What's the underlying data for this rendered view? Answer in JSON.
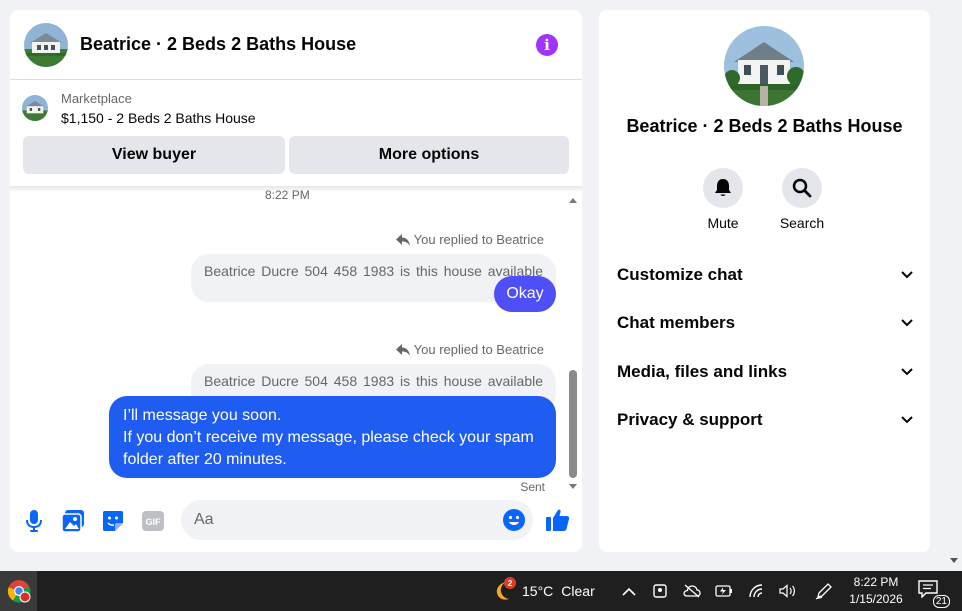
{
  "chat": {
    "title": "Beatrice · 2 Beds 2 Baths House",
    "info_glyph": "i",
    "marketplace_label": "Marketplace",
    "listing": "$1,150 - 2 Beds 2 Baths House",
    "view_buyer": "View buyer",
    "more_options": "More options",
    "timestamp": "8:22 PM",
    "messages": [
      {
        "reply_note": "You replied to Beatrice",
        "quote": "Beatrice  Ducre  504 458 1983 is this house available",
        "text": "Okay"
      },
      {
        "reply_note": "You replied to Beatrice",
        "quote": "Beatrice  Ducre  504 458 1983 is this house available",
        "lines": [
          "I’ll message you soon.",
          "If you don’t receive my message, please check your spam",
          "folder after 20 minutes."
        ]
      }
    ],
    "status": "Sent",
    "composer_placeholder": "Aa",
    "accent": "#0866ff",
    "bubble_colors": [
      "#4e4ff7",
      "#1f5cf2"
    ]
  },
  "side": {
    "title": "Beatrice · 2 Beds 2 Baths House",
    "mute": "Mute",
    "search": "Search",
    "menu": [
      "Customize chat",
      "Chat members",
      "Media, files and links",
      "Privacy & support"
    ]
  },
  "taskbar": {
    "weather_temp": "15°C",
    "weather_cond": "Clear",
    "weather_badge": "2",
    "time": "8:22 PM",
    "date": "1/15/2026",
    "notif_count": "21"
  }
}
